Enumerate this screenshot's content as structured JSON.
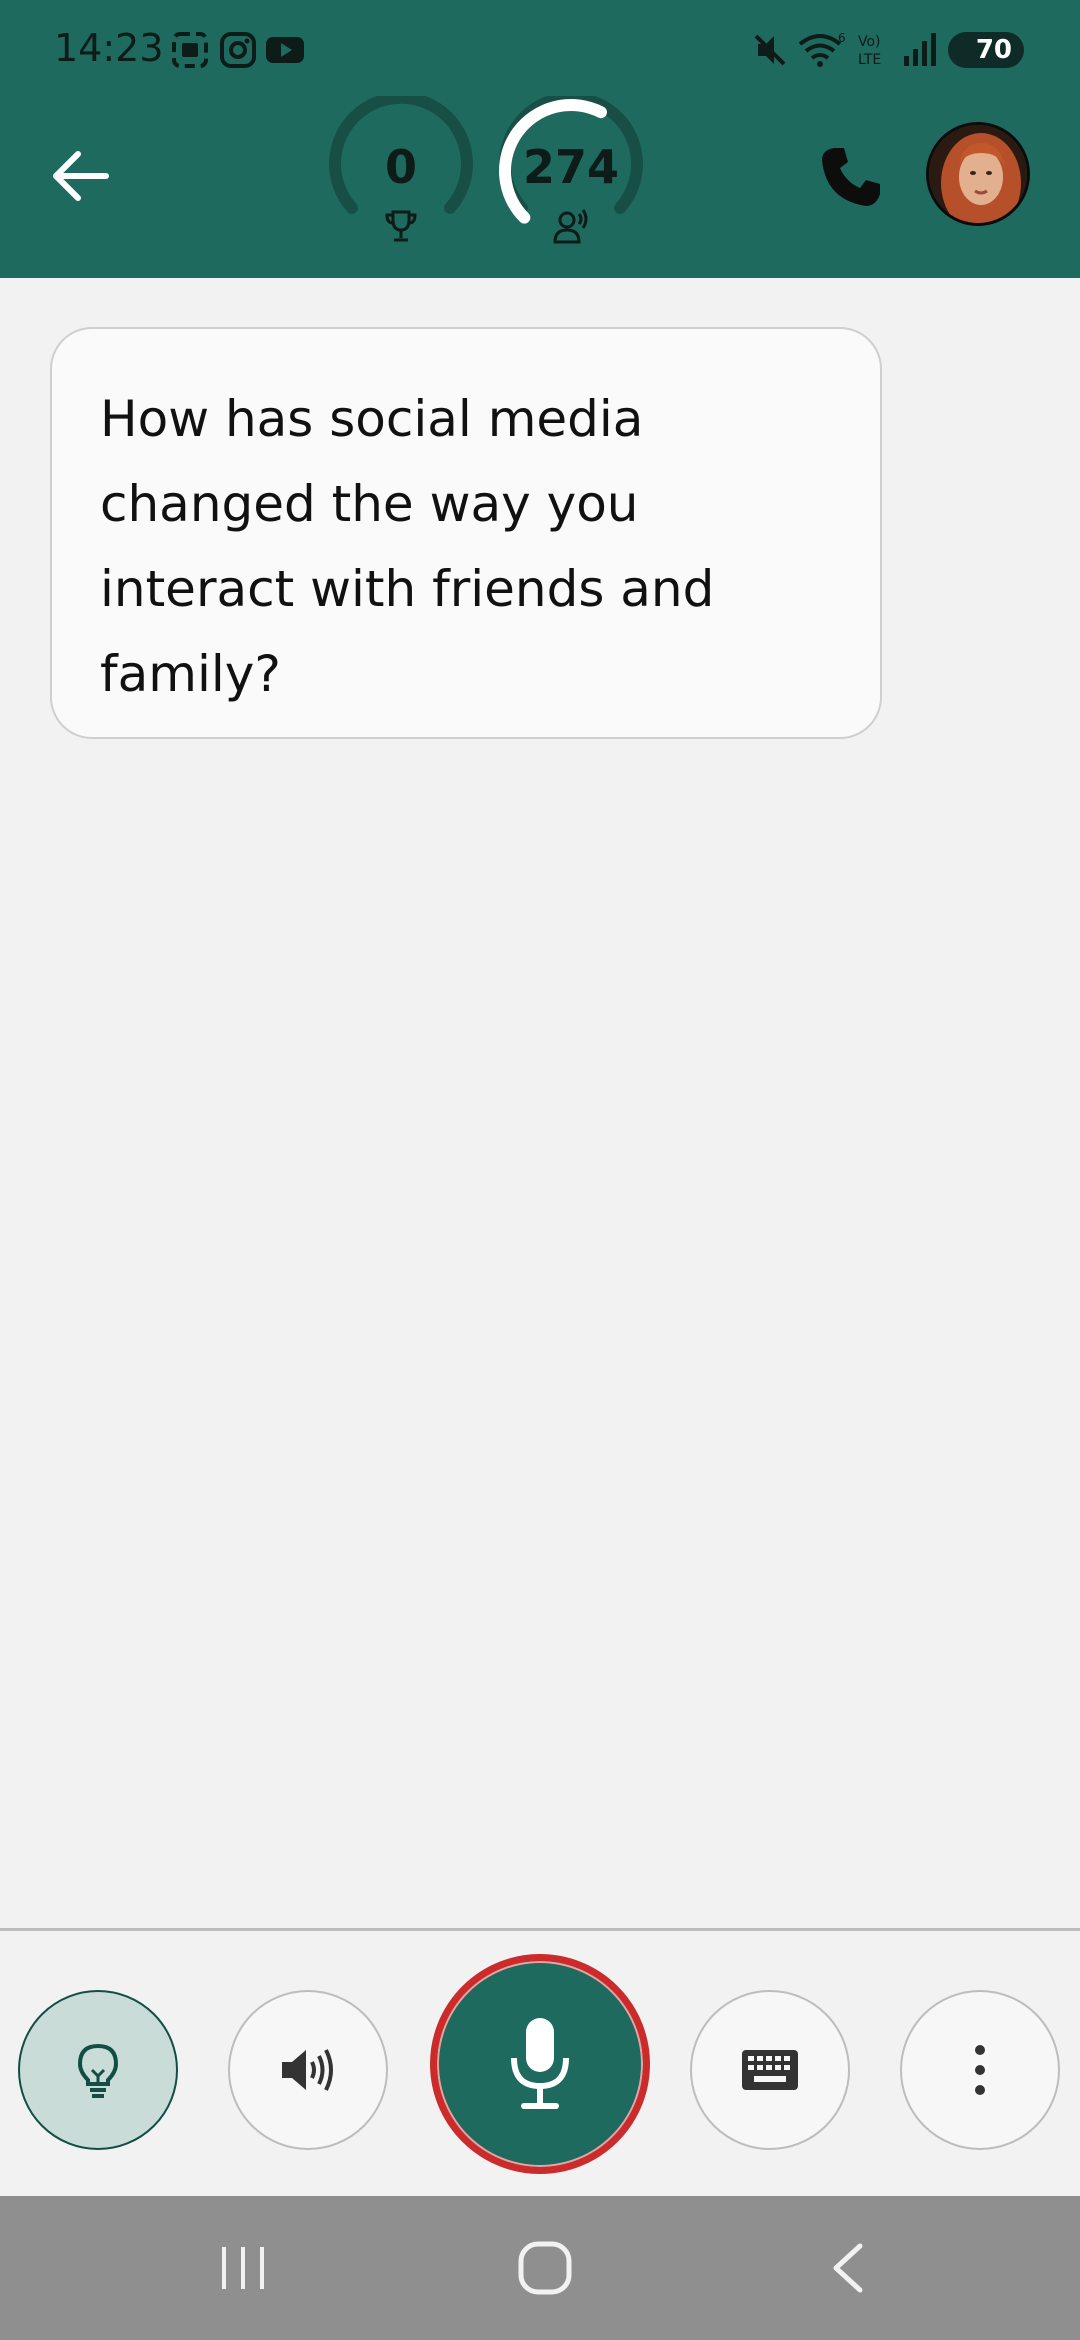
{
  "status_bar": {
    "time": "14:23",
    "battery": "70"
  },
  "header": {
    "score_value": "0",
    "score_icon": "trophy-icon",
    "listeners_value": "274",
    "listeners_icon": "person-speaking-icon",
    "listeners_progress": 0.6
  },
  "chat": {
    "message": "How has social media changed the way you interact with friends and family?"
  },
  "controls": {
    "hint_icon": "lightbulb-icon",
    "speaker_icon": "speaker-icon",
    "mic_icon": "microphone-icon",
    "keyboard_icon": "keyboard-icon",
    "more_icon": "more-vertical-icon"
  },
  "colors": {
    "primary": "#1e6a5f",
    "mic_ring": "#cc2b2b",
    "background": "#f2f2f2",
    "nav_bar": "#8f8f8f"
  }
}
